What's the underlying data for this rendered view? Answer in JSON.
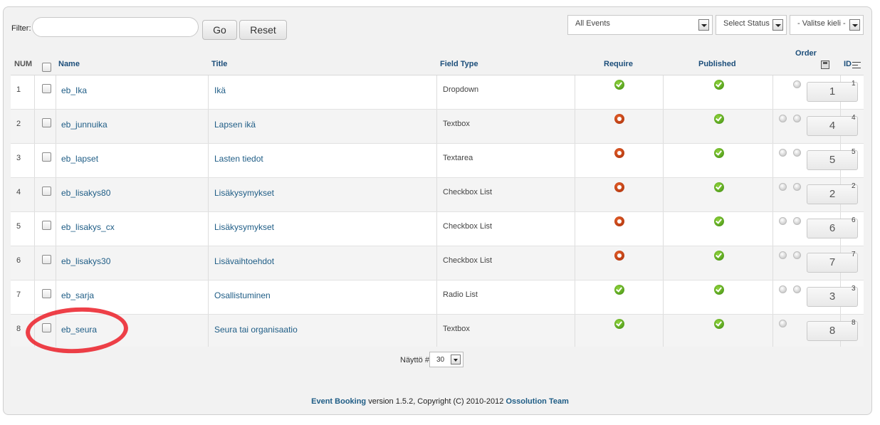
{
  "toolbar": {
    "filter_label": "Filter:",
    "filter_value": "",
    "go_label": "Go",
    "reset_label": "Reset",
    "event_select": "All Events",
    "status_select": "Select Status",
    "language_select": "- Valitse kieli -"
  },
  "columns": {
    "num": "NUM",
    "name": "Name",
    "title": "Title",
    "field_type": "Field Type",
    "require": "Require",
    "published": "Published",
    "order": "Order",
    "id": "ID"
  },
  "rows": [
    {
      "num": "1",
      "name": "eb_Ika",
      "title": "Ikä",
      "field_type": "Dropdown",
      "require": "yes",
      "published": "yes",
      "order": "1",
      "id": "1",
      "arrows": "down"
    },
    {
      "num": "2",
      "name": "eb_junnuika",
      "title": "Lapsen ikä",
      "field_type": "Textbox",
      "require": "no",
      "published": "yes",
      "order": "4",
      "id": "4",
      "arrows": "both"
    },
    {
      "num": "3",
      "name": "eb_lapset",
      "title": "Lasten tiedot",
      "field_type": "Textarea",
      "require": "no",
      "published": "yes",
      "order": "5",
      "id": "5",
      "arrows": "both"
    },
    {
      "num": "4",
      "name": "eb_lisakys80",
      "title": "Lisäkysymykset",
      "field_type": "Checkbox List",
      "require": "no",
      "published": "yes",
      "order": "2",
      "id": "2",
      "arrows": "both"
    },
    {
      "num": "5",
      "name": "eb_lisakys_cx",
      "title": "Lisäkysymykset",
      "field_type": "Checkbox List",
      "require": "no",
      "published": "yes",
      "order": "6",
      "id": "6",
      "arrows": "both"
    },
    {
      "num": "6",
      "name": "eb_lisakys30",
      "title": "Lisävaihtoehdot",
      "field_type": "Checkbox List",
      "require": "no",
      "published": "yes",
      "order": "7",
      "id": "7",
      "arrows": "both"
    },
    {
      "num": "7",
      "name": "eb_sarja",
      "title": "Osallistuminen",
      "field_type": "Radio List",
      "require": "yes",
      "published": "yes",
      "order": "3",
      "id": "3",
      "arrows": "both"
    },
    {
      "num": "8",
      "name": "eb_seura",
      "title": "Seura tai organisaatio",
      "field_type": "Textbox",
      "require": "yes",
      "published": "yes",
      "order": "8",
      "id": "8",
      "arrows": "up"
    }
  ],
  "pagination": {
    "limit_label": "Näyttö #",
    "limit_value": "30"
  },
  "footer": {
    "product": "Event Booking",
    "text": " version 1.5.2, Copyright (C) 2010-2012 ",
    "company": "Ossolution Team"
  },
  "colors": {
    "link": "#1f5d86",
    "header_text": "#1c4e7a",
    "published_ok": "#3d8a12",
    "require_no": "#a62e09",
    "annotation": "#eb1e28"
  }
}
